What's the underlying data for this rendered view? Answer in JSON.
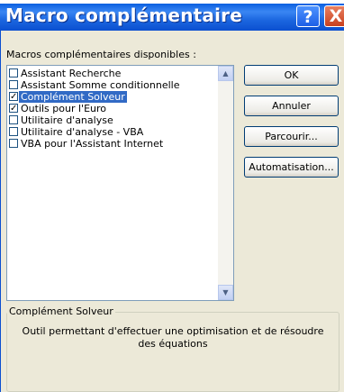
{
  "window": {
    "title": "Macro complémentaire",
    "help_label": "?",
    "close_label": "X",
    "accent": "#0b4fd0"
  },
  "addins": {
    "caption": "Macros complémentaires disponibles :",
    "items": [
      {
        "label": "Assistant Recherche",
        "checked": false,
        "selected": false
      },
      {
        "label": "Assistant Somme conditionnelle",
        "checked": false,
        "selected": false
      },
      {
        "label": "Complément Solveur",
        "checked": true,
        "selected": true
      },
      {
        "label": "Outils pour l'Euro",
        "checked": true,
        "selected": false
      },
      {
        "label": "Utilitaire d'analyse",
        "checked": false,
        "selected": false
      },
      {
        "label": "Utilitaire d'analyse - VBA",
        "checked": false,
        "selected": false
      },
      {
        "label": "VBA pour l'Assistant Internet",
        "checked": false,
        "selected": false
      }
    ],
    "scroll_up_icon": "scroll-up-arrow",
    "scroll_down_icon": "scroll-down-arrow"
  },
  "buttons": {
    "ok": "OK",
    "annuler": "Annuler",
    "parcourir": "Parcourir...",
    "automatisation": "Automatisation..."
  },
  "description": {
    "title": "Complément Solveur",
    "text": "Outil permettant d'effectuer une optimisation et de résoudre des équations"
  }
}
